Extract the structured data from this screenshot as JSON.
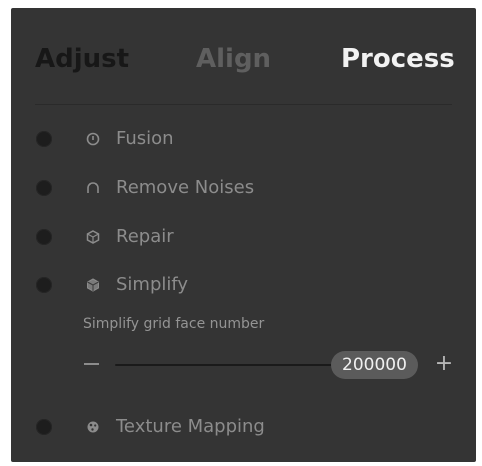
{
  "tabs": [
    {
      "label": "Adjust"
    },
    {
      "label": "Align"
    },
    {
      "label": "Process"
    }
  ],
  "items": [
    {
      "label": "Fusion",
      "icon": "fusion-icon"
    },
    {
      "label": "Remove Noises",
      "icon": "remove-noises-icon"
    },
    {
      "label": "Repair",
      "icon": "repair-icon"
    },
    {
      "label": "Simplify",
      "icon": "simplify-icon"
    },
    {
      "label": "Texture Mapping",
      "icon": "texture-mapping-icon"
    }
  ],
  "simplify": {
    "sub_label": "Simplify grid face number",
    "value": "200000",
    "minus_label": "—",
    "plus_label": "+"
  },
  "colors": {
    "panel": "#343434",
    "active_tab": "#f2f2f2",
    "inactive_tab": "#5f5f5f",
    "label": "#8c8c8c"
  }
}
